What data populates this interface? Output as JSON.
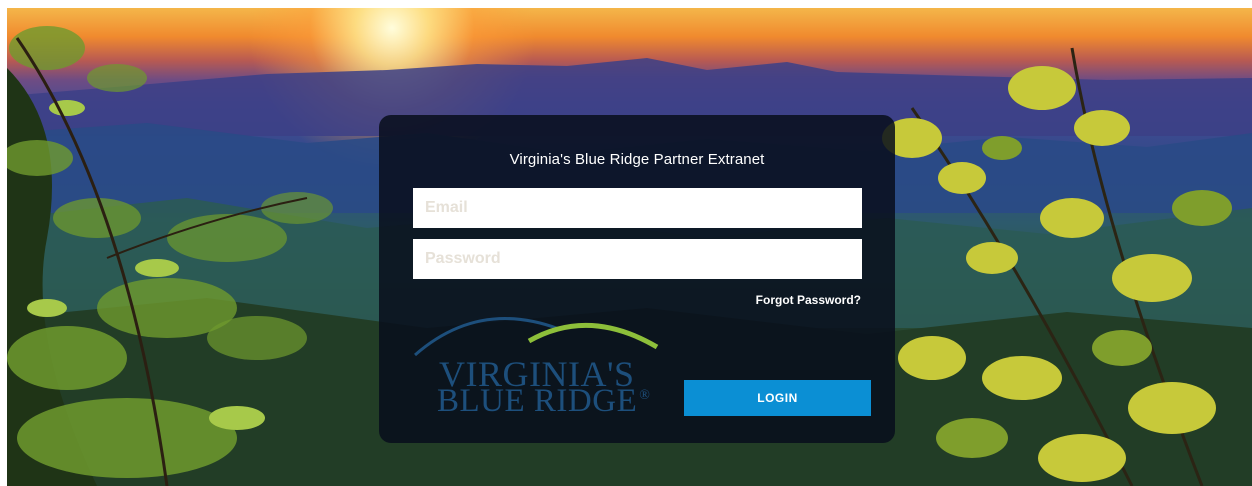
{
  "login": {
    "title": "Virginia's Blue Ridge Partner Extranet",
    "email_placeholder": "Email",
    "password_placeholder": "Password",
    "forgot_label": "Forgot Password?",
    "login_label": "LOGIN"
  },
  "logo": {
    "line1": "VIRGINIA'S",
    "line2": "BLUE RIDGE",
    "registered": "®"
  },
  "colors": {
    "panel": "#080e1c",
    "button": "#0b8fd4",
    "logo_text": "#1d4f7c",
    "arc_blue": "#1d4f7c",
    "arc_green": "#8dbf3a"
  },
  "icons": {
    "logo_arcs": "mountain-arcs-icon"
  }
}
